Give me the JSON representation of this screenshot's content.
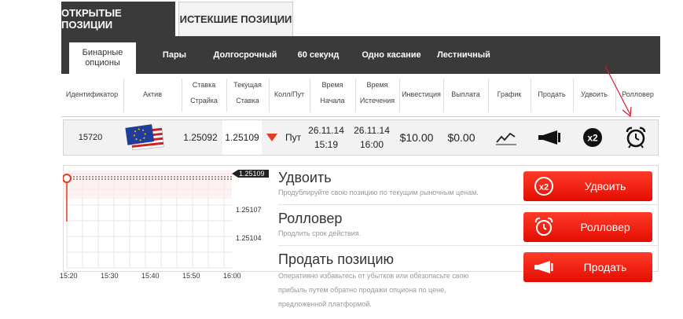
{
  "tabs": {
    "open": "ОТКРЫТЫЕ ПОЗИЦИИ",
    "expired": "ИСТЕКШИЕ ПОЗИЦИИ"
  },
  "subtabs": [
    "Бинарные опционы",
    "Пары",
    "Долгосрочный",
    "60 секунд",
    "Одно касание",
    "Лестничный"
  ],
  "columns": {
    "id": "Идентификатор",
    "asset": "Актив",
    "strike1": "Ставка",
    "strike2": "Страйка",
    "current1": "Текущая",
    "current2": "Ставка",
    "callput": "Колл/Пут",
    "start1": "Время",
    "start2": "Начала",
    "expiry1": "Время",
    "expiry2": "Истечения",
    "investment": "Инвестиция",
    "payout": "Выплата",
    "chart": "График",
    "sell": "Продать",
    "double": "Удвоить",
    "rollover": "Ролловер"
  },
  "position": {
    "id": "15720",
    "asset_icon": "us-eu-flag-icon",
    "strike": "1.25092",
    "current": "1.25109",
    "direction": "Пут",
    "start_date": "26.11.14",
    "start_time": "15:19",
    "expiry_date": "26.11.14",
    "expiry_time": "16:00",
    "investment": "$10.00",
    "payout": "$0.00"
  },
  "chart": {
    "y_ticks": [
      "1.25109",
      "1.25107",
      "1.25104"
    ],
    "x_ticks": [
      "15:20",
      "15:30",
      "15:40",
      "15:50",
      "16:00"
    ],
    "current_label": "1.25109"
  },
  "actions": {
    "double": {
      "title": "Удвоить",
      "desc": "Продублируйте свою позицию по текущим рыночным ценам.",
      "button": "Удвоить"
    },
    "rollover": {
      "title": "Ролловер",
      "desc": "Продлить срок действия.",
      "button": "Ролловер"
    },
    "sell": {
      "title": "Продать позицию",
      "desc1": "Оперативно избавьтесь от убытков или обезопасьте свою",
      "desc2": "прибыль путем обратно продажи опциона по цене,",
      "desc3": "предложенной платформой.",
      "button": "Продать"
    }
  },
  "colors": {
    "accent": "#e8190a",
    "dark": "#3a3a3a",
    "down_arrow": "#e53a1e",
    "annotation": "#d41a3a"
  }
}
